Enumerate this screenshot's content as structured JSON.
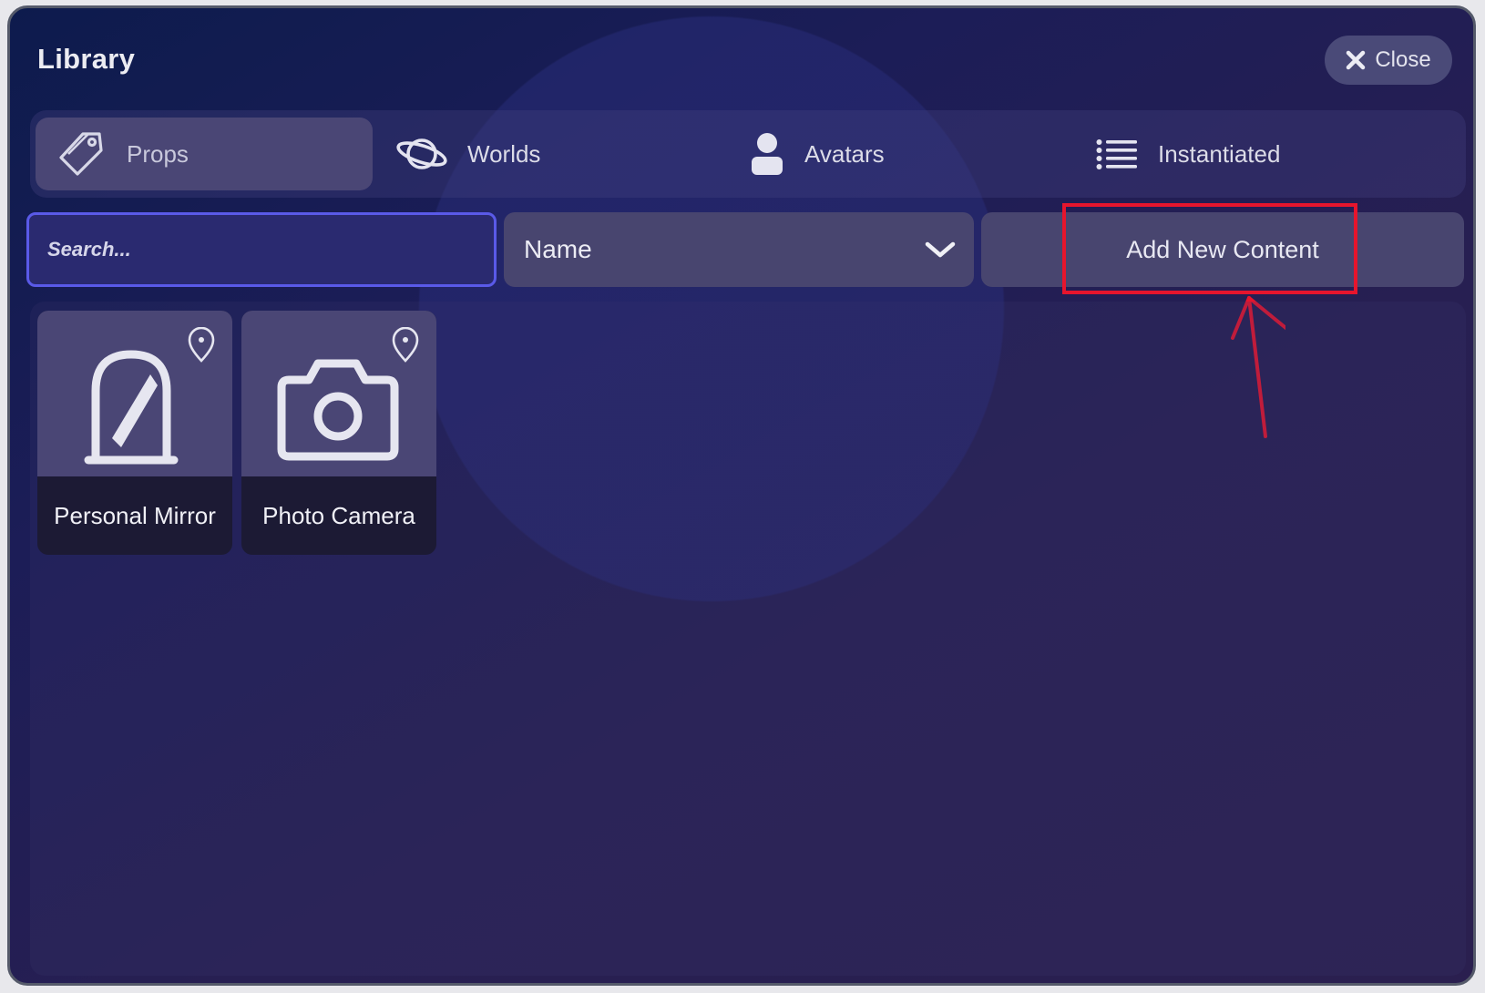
{
  "window": {
    "title": "Library",
    "close_label": "Close"
  },
  "tabs": [
    {
      "label": "Props",
      "icon": "tag-icon",
      "active": true
    },
    {
      "label": "Worlds",
      "icon": "planet-icon",
      "active": false
    },
    {
      "label": "Avatars",
      "icon": "person-icon",
      "active": false
    },
    {
      "label": "Instantiated",
      "icon": "list-icon",
      "active": false
    }
  ],
  "toolbar": {
    "search_placeholder": "Search...",
    "sort_value": "Name",
    "add_label": "Add New Content"
  },
  "items": [
    {
      "name": "Personal Mirror",
      "icon": "mirror-icon"
    },
    {
      "name": "Photo Camera",
      "icon": "camera-icon"
    }
  ],
  "colors": {
    "accent": "#5a5ae8",
    "annotation": "#e6152d",
    "panel": "#48456f"
  }
}
